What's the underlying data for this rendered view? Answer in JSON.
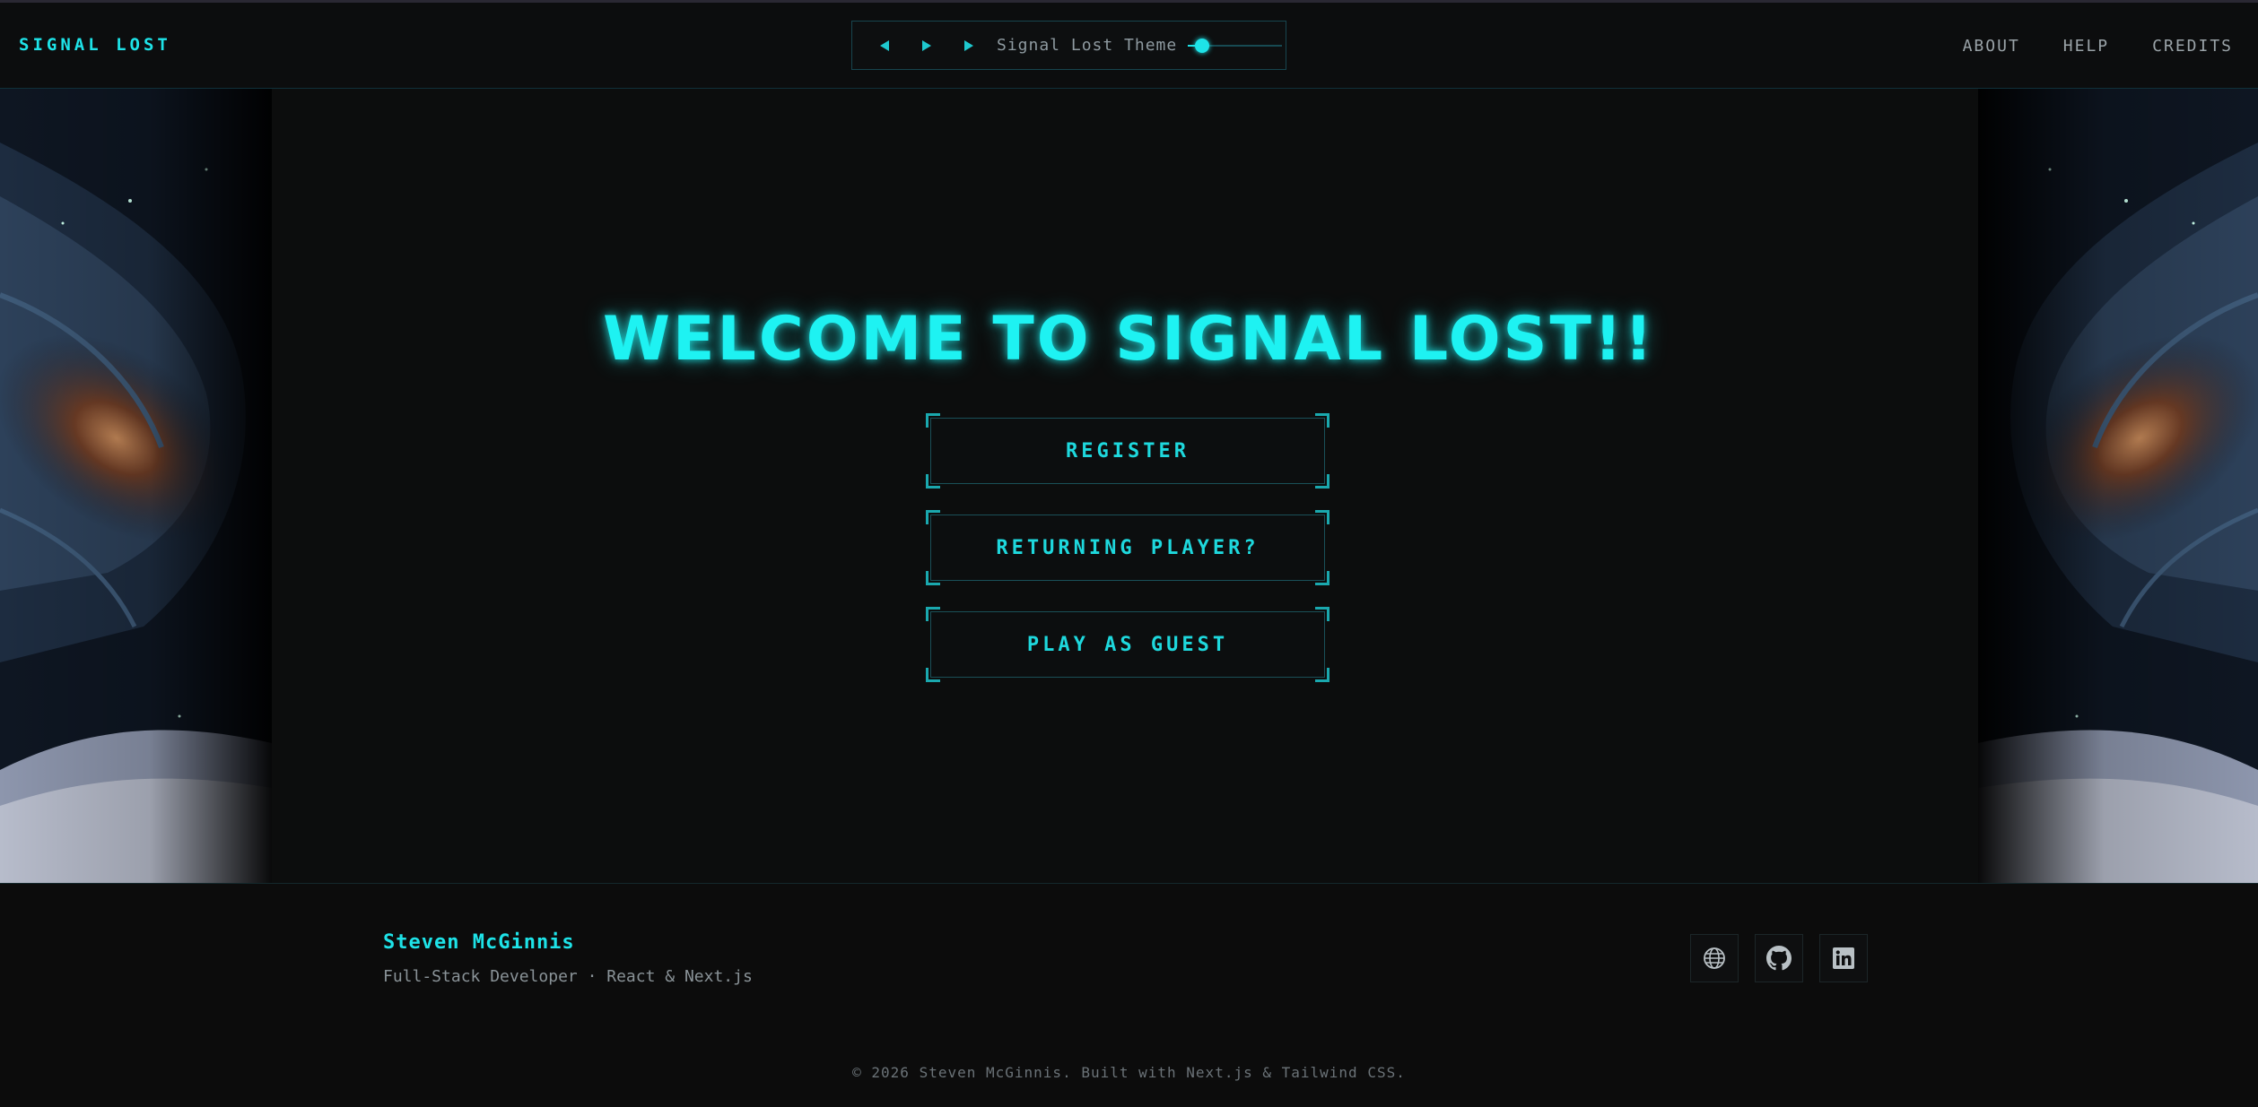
{
  "header": {
    "brand": "SIGNAL LOST",
    "player": {
      "track": "Signal Lost Theme",
      "volume": 0.15,
      "controls": [
        "previous-icon",
        "play-icon",
        "next-icon"
      ]
    },
    "nav": [
      {
        "label": "ABOUT"
      },
      {
        "label": "HELP"
      },
      {
        "label": "CREDITS"
      }
    ]
  },
  "main": {
    "title": "WELCOME TO SIGNAL LOST!!",
    "buttons": [
      {
        "label": "REGISTER"
      },
      {
        "label": "RETURNING PLAYER?"
      },
      {
        "label": "PLAY AS GUEST"
      }
    ]
  },
  "footer": {
    "author": "Steven McGinnis",
    "role": "Full-Stack Developer · React & Next.js",
    "socials": [
      "globe-icon",
      "github-icon",
      "linkedin-icon"
    ],
    "copyright": "© 2026 Steven McGinnis. Built with Next.js & Tailwind CSS."
  },
  "colors": {
    "accent": "#1ee3e8",
    "background": "#0b0c0d",
    "border": "#17454e"
  }
}
